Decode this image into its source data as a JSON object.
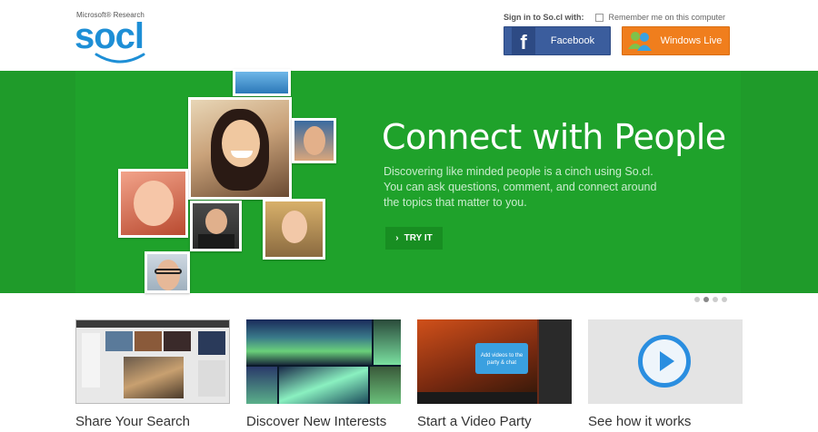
{
  "logo": {
    "tagline": "Microsoft® Research",
    "word": "socl"
  },
  "signin": {
    "label": "Sign in to So.cl with:",
    "remember": "Remember me on this computer"
  },
  "buttons": {
    "facebook": "Facebook",
    "facebook_mark": "f",
    "windows_live": "Windows Live"
  },
  "hero": {
    "title": "Connect with People",
    "description": "Discovering like minded people is a cinch using So.cl. You can ask questions, comment, and connect around the topics that matter to you.",
    "try_label": "TRY IT",
    "slide_count": 4,
    "active_slide": 2
  },
  "tiles": [
    {
      "label": "Share Your Search"
    },
    {
      "label": "Discover New Interests"
    },
    {
      "label": "Start a Video Party",
      "callout": "Add videos to the party & chat"
    },
    {
      "label": "See how it works"
    }
  ],
  "colors": {
    "brand_blue": "#1e8fd6",
    "hero_green": "#22a52e",
    "facebook": "#3b5d9d",
    "windows_live": "#f07e1d"
  }
}
